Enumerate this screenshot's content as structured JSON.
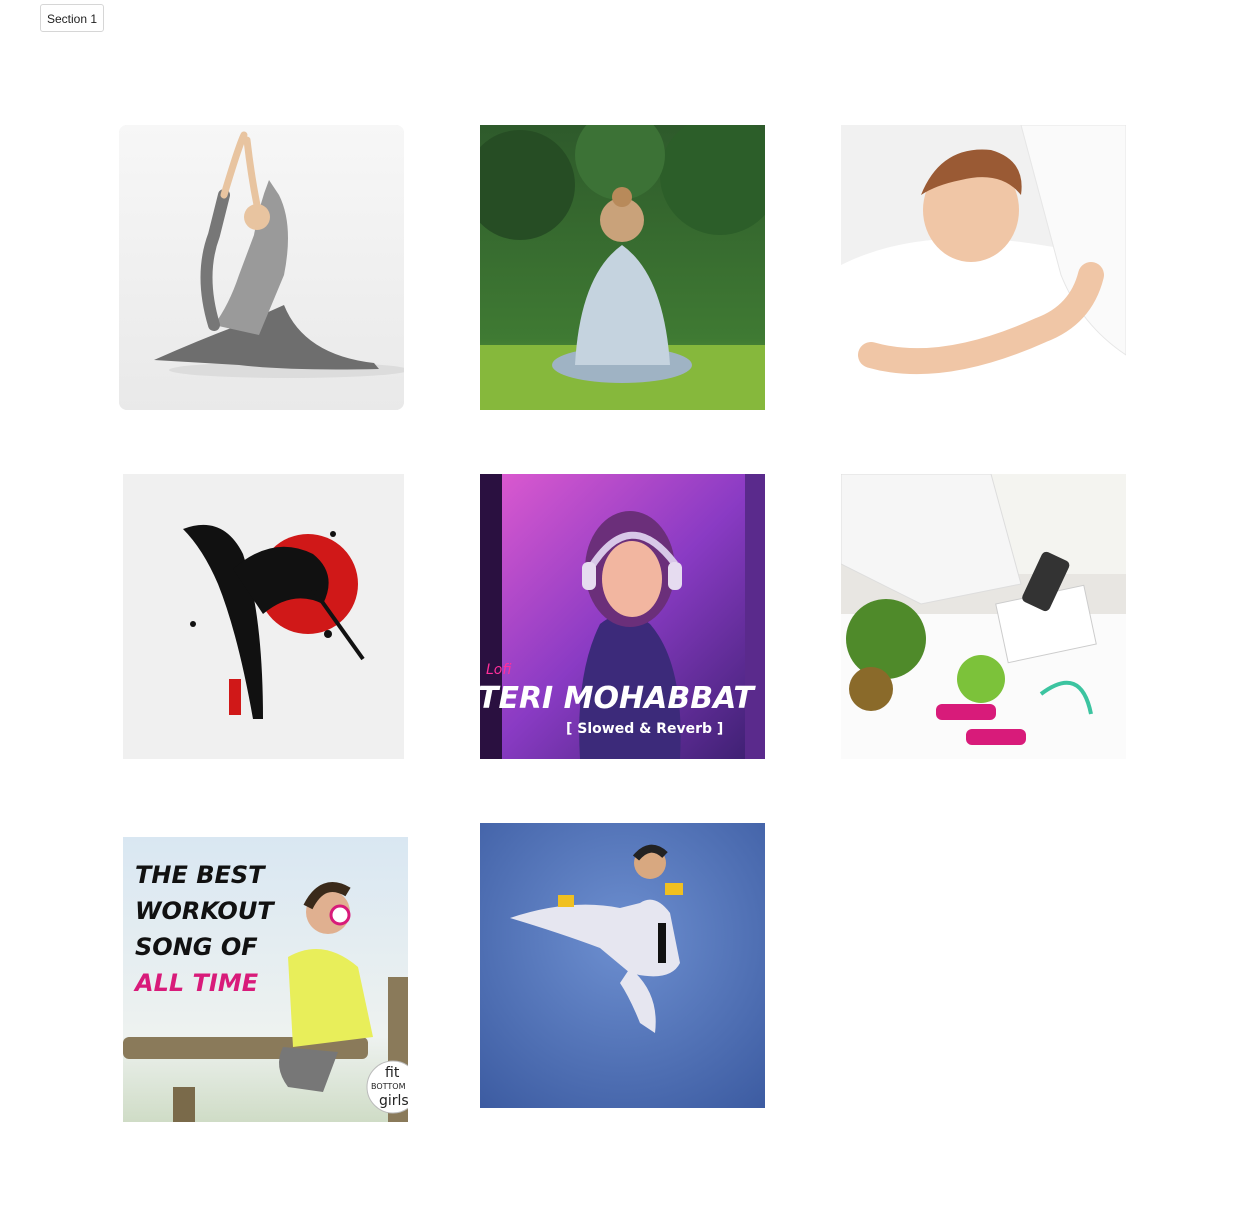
{
  "header": {
    "section_tab_label": "Section 1"
  },
  "gallery": {
    "tiles": [
      {
        "subject": "yoga-pose"
      },
      {
        "subject": "meditation-outdoors"
      },
      {
        "subject": "sleeping-woman"
      },
      {
        "subject": "karate-ink-art"
      },
      {
        "subject": "lofi-song-cover",
        "badge": "Lofi",
        "title": "TERI MOHABBAT NE",
        "subtitle": "[ Slowed & Reverb ]"
      },
      {
        "subject": "nutrition-consultation"
      },
      {
        "subject": "workout-song-cover",
        "line1": "THE BEST",
        "line2": "WORKOUT",
        "line3": "SONG OF",
        "line4": "ALL TIME",
        "logo_top": "fit",
        "logo_mid": "BOTTOM",
        "logo_bottom": "girls"
      },
      {
        "subject": "karate-flying-kick"
      }
    ]
  },
  "colors": {
    "accent_pink": "#d81b7a",
    "lofi_purple": "#5a2a8c",
    "karate_red": "#d01818",
    "kick_blue": "#4a6fb5"
  }
}
